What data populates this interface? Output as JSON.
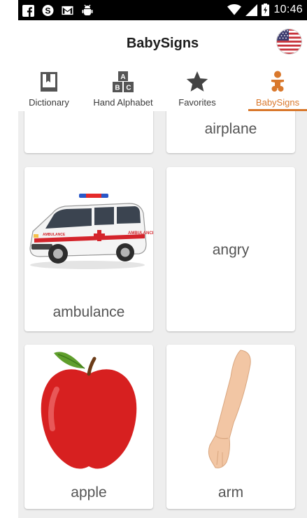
{
  "status_bar": {
    "time": "10:46"
  },
  "app": {
    "title": "BabySigns"
  },
  "tabs": [
    {
      "label": "Dictionary",
      "icon": "dictionary-icon"
    },
    {
      "label": "Hand Alphabet",
      "icon": "alphabet-blocks-icon"
    },
    {
      "label": "Favorites",
      "icon": "star-icon"
    },
    {
      "label": "BabySigns",
      "icon": "baby-icon",
      "active": true
    }
  ],
  "cards": [
    {
      "label": "",
      "image": ""
    },
    {
      "label": "airplane",
      "image": ""
    },
    {
      "label": "ambulance",
      "image": "ambulance-image"
    },
    {
      "label": "angry",
      "image": ""
    },
    {
      "label": "apple",
      "image": "apple-image"
    },
    {
      "label": "arm",
      "image": "arm-image"
    }
  ],
  "colors": {
    "accent": "#d9782c",
    "status_bar": "#000000",
    "grid_background": "#eeeeee"
  }
}
